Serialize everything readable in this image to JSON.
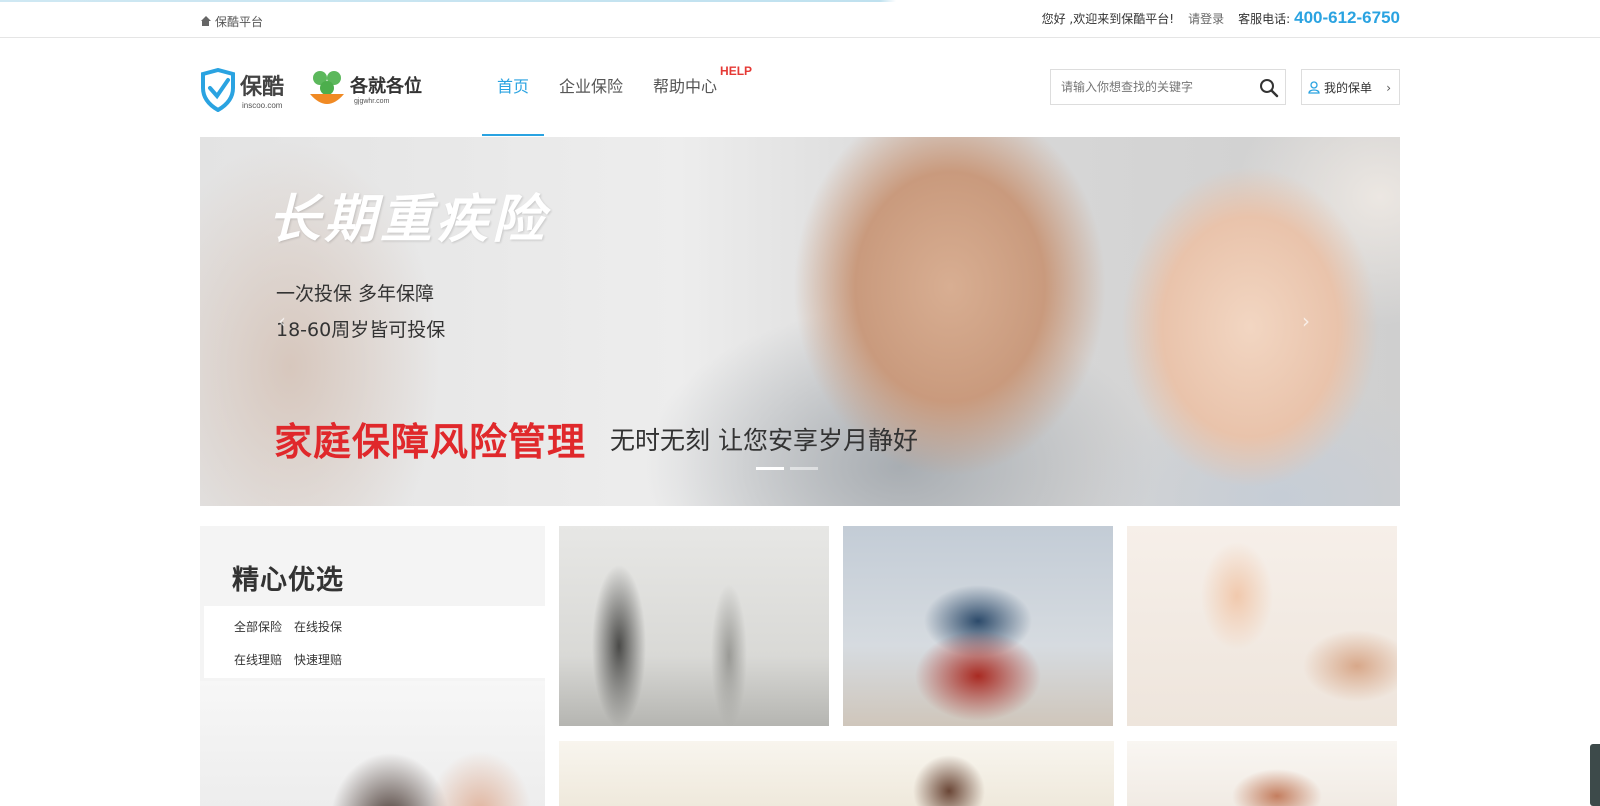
{
  "topbar": {
    "home_link": "保酷平台",
    "welcome": "您好 ,欢迎来到保酷平台!",
    "login": "请登录",
    "hotline_label": "客服电话:",
    "hotline": "400-612-6750"
  },
  "header": {
    "logo_inscoo_text": "保酷",
    "logo_inscoo_domain": "inscoo.com",
    "logo_gjgw_text": "各就各位",
    "logo_gjgw_domain": "gjgwhr.com",
    "nav": [
      {
        "label": "首页",
        "active": true
      },
      {
        "label": "企业保险",
        "active": false
      },
      {
        "label": "帮助中心",
        "active": false,
        "badge": "HELP"
      }
    ],
    "search_placeholder": "请输入你想查找的关键字",
    "my_policy": "我的保单"
  },
  "banner": {
    "title": "长期重疾险",
    "line1": "一次投保 多年保障",
    "line2": "18-60周岁皆可投保",
    "red_text": "家庭保障风险管理",
    "slogan": "无时无刻 让您安享岁月静好",
    "slides": 2,
    "active_slide": 1
  },
  "picks": {
    "title": "精心优选",
    "links": [
      "全部保险",
      "在线投保",
      "在线理赔",
      "快速理赔"
    ]
  },
  "colors": {
    "accent": "#2aa3e1",
    "help_red": "#e53935",
    "banner_red": "#e0282b"
  }
}
